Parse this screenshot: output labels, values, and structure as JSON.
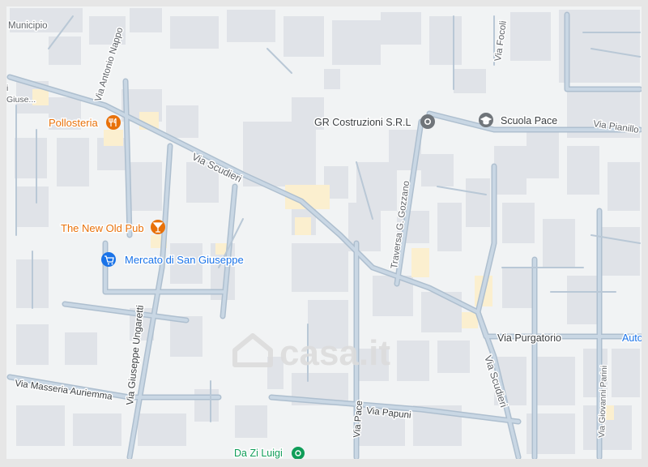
{
  "colors": {
    "land": "#f1f3f4",
    "block": "#e0e3e8",
    "road_casing": "#aebfcf",
    "road_fill": "#c9d7e4",
    "highlight": "#fbefcf",
    "poi_orange": "#e8710a",
    "poi_blue": "#1a73e8",
    "poi_gray": "#70757a",
    "poi_green": "#0f9d58",
    "street_text": "#5f6368",
    "watermark": "#dcdcdc"
  },
  "streets": {
    "municipio": "Municipio",
    "antonio_nappo": "Via Antonio Nappo",
    "scudieri_top": "Via Scudieri",
    "scudieri_right": "Via Scudieri",
    "gozzano": "Traversa G. Gozzano",
    "focoli": "Via Focoli",
    "pianillo": "Via Pianillo",
    "purgatorio": "Via Purgatorio",
    "auto_cut": "Auto",
    "ungaretti": "Via Giuseppe Ungaretti",
    "masseria": "Via Masseria Auriemma",
    "pace": "Via Pace",
    "papuni": "Via Papuni",
    "parini": "Via Giovanni Parini",
    "giuse_cut": "Giuse...",
    "edge_i": "i"
  },
  "pois": {
    "pollosteria": {
      "label": "Pollosteria",
      "icon": "restaurant-icon"
    },
    "pub": {
      "label": "The New Old Pub",
      "icon": "bar-icon"
    },
    "mercato": {
      "label": "Mercato di San Giuseppe",
      "icon": "shopping-cart-icon"
    },
    "gr": {
      "label": "GR Costruzioni S.R.L",
      "icon": "location-pin-icon"
    },
    "scuola": {
      "label": "Scuola Pace",
      "icon": "school-icon"
    },
    "zi_luigi": {
      "label": "Da Zi Luigi",
      "icon": "restaurant-icon"
    }
  },
  "watermark": {
    "text": "casa.it",
    "icon": "house-icon"
  }
}
